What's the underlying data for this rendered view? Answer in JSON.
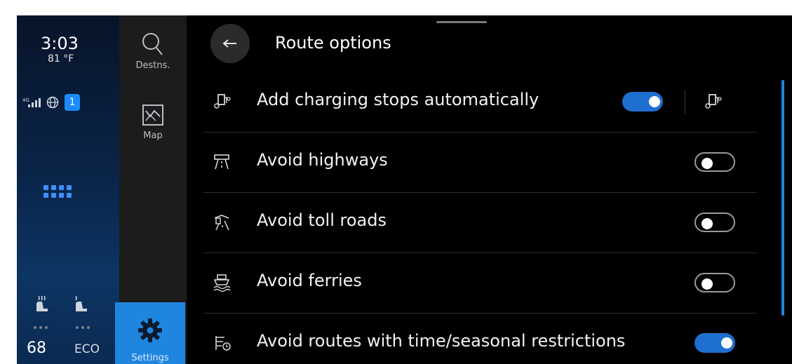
{
  "status": {
    "time": "3:03",
    "temperature": "81 °F",
    "badge_count": "1",
    "cabin_temp": "68",
    "mode": "ECO"
  },
  "nav": {
    "destinations": "Destns.",
    "map": "Map",
    "settings": "Settings"
  },
  "page": {
    "title": "Route options"
  },
  "options": [
    {
      "label": "Add charging stops automatically",
      "enabled": true,
      "icon": "charging-stop-icon"
    },
    {
      "label": "Avoid highways",
      "enabled": false,
      "icon": "highway-icon"
    },
    {
      "label": "Avoid toll roads",
      "enabled": false,
      "icon": "toll-road-icon"
    },
    {
      "label": "Avoid ferries",
      "enabled": false,
      "icon": "ferry-icon"
    },
    {
      "label": "Avoid routes with time/seasonal restrictions",
      "enabled": true,
      "icon": "restriction-icon"
    }
  ],
  "colors": {
    "accent": "#1f86e0",
    "toggle_on": "#1f6fd0",
    "background": "#000000"
  }
}
